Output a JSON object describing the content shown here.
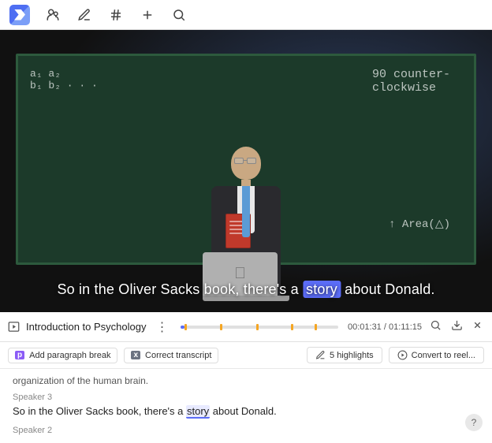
{
  "toolbar": {
    "logo_label": "App Logo",
    "icons": [
      "people-icon",
      "pen-icon",
      "hash-icon",
      "plus-icon",
      "search-circle-icon"
    ]
  },
  "video": {
    "subtitle": "So in the Oliver Sacks book, there's a ",
    "subtitle_highlight": "story",
    "subtitle_end": " about Donald.",
    "bg_color": "#1a1a2e"
  },
  "controls": {
    "title": "Introduction to Psychology",
    "more_icon": "⋮",
    "time_current": "00:01:31",
    "time_total": "01:11:15",
    "search_icon": "🔍",
    "download_icon": "⬇",
    "close_icon": "✕",
    "progress_pct": 2.5
  },
  "action_bar": {
    "paragraph_label": "p",
    "paragraph_text": "Add paragraph break",
    "correct_label": "x",
    "correct_text": "Correct transcript",
    "highlights_icon": "✏",
    "highlights_count": "5 highlights",
    "convert_icon": "⟳",
    "convert_text": "Convert to reel..."
  },
  "transcript": {
    "org_label": "organization of the human brain.",
    "speaker1": "Speaker 3",
    "line1_before": "So in the Oliver Sacks book, there's a ",
    "line1_highlight": "story",
    "line1_after": " about Donald.",
    "speaker2": "Speaker 2"
  },
  "help": {
    "label": "?"
  }
}
